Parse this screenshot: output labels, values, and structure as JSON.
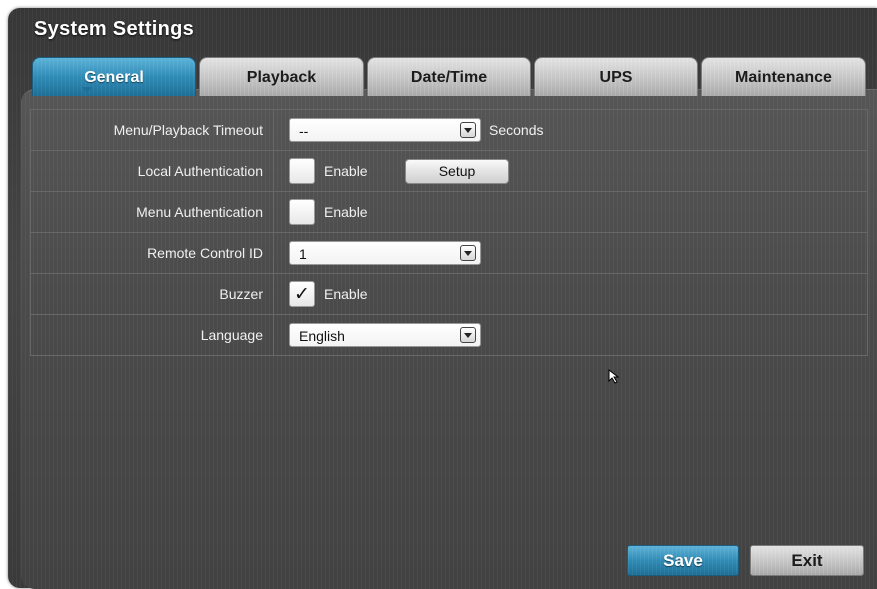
{
  "window": {
    "title": "System Settings"
  },
  "tabs": [
    {
      "label": "General",
      "active": true
    },
    {
      "label": "Playback",
      "active": false
    },
    {
      "label": "Date/Time",
      "active": false
    },
    {
      "label": "UPS",
      "active": false
    },
    {
      "label": "Maintenance",
      "active": false
    }
  ],
  "settings": {
    "menu_playback_timeout": {
      "label": "Menu/Playback Timeout",
      "value": "--",
      "unit": "Seconds"
    },
    "local_authentication": {
      "label": "Local Authentication",
      "checked": false,
      "checkbox_label": "Enable",
      "setup_button": "Setup"
    },
    "menu_authentication": {
      "label": "Menu Authentication",
      "checked": false,
      "checkbox_label": "Enable"
    },
    "remote_control_id": {
      "label": "Remote Control ID",
      "value": "1"
    },
    "buzzer": {
      "label": "Buzzer",
      "checked": true,
      "checkbox_label": "Enable"
    },
    "language": {
      "label": "Language",
      "value": "English"
    }
  },
  "footer": {
    "save_label": "Save",
    "exit_label": "Exit"
  },
  "icons": {
    "checkmark": "✓",
    "cursor": "mouse-pointer-icon"
  },
  "colors": {
    "accent": "#2f8bb5",
    "background": "#474747",
    "tab_inactive": "#c4c4c4"
  }
}
